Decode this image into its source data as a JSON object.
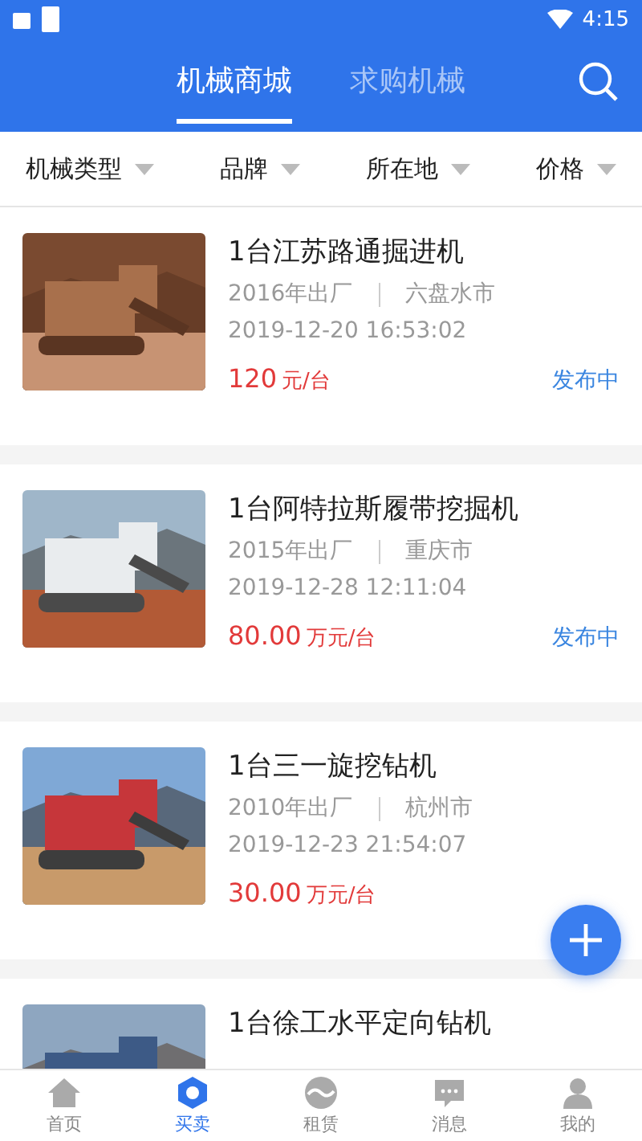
{
  "status_bar": {
    "time": "4:15"
  },
  "header": {
    "tabs": [
      {
        "label": "机械商城",
        "selected": true
      },
      {
        "label": "求购机械",
        "selected": false
      }
    ]
  },
  "filters": [
    {
      "label": "机械类型"
    },
    {
      "label": "品牌"
    },
    {
      "label": "所在地"
    },
    {
      "label": "价格"
    }
  ],
  "listings": [
    {
      "title": "1台江苏路通掘进机",
      "year": "2016年出厂",
      "city": "六盘水市",
      "date": "2019-12-20 16:53:02",
      "price": "120",
      "unit": "元/台",
      "status": "发布中"
    },
    {
      "title": "1台阿特拉斯履带挖掘机",
      "year": "2015年出厂",
      "city": "重庆市",
      "date": "2019-12-28 12:11:04",
      "price": "80.00",
      "unit": "万元/台",
      "status": "发布中"
    },
    {
      "title": "1台三一旋挖钻机",
      "year": "2010年出厂",
      "city": "杭州市",
      "date": "2019-12-23 21:54:07",
      "price": "30.00",
      "unit": "万元/台"
    },
    {
      "title": "1台徐工水平定向钻机"
    }
  ],
  "nav": [
    {
      "label": "首页",
      "selected": false
    },
    {
      "label": "买卖",
      "selected": true
    },
    {
      "label": "租赁",
      "selected": false
    },
    {
      "label": "消息",
      "selected": false
    },
    {
      "label": "我的",
      "selected": false
    }
  ]
}
